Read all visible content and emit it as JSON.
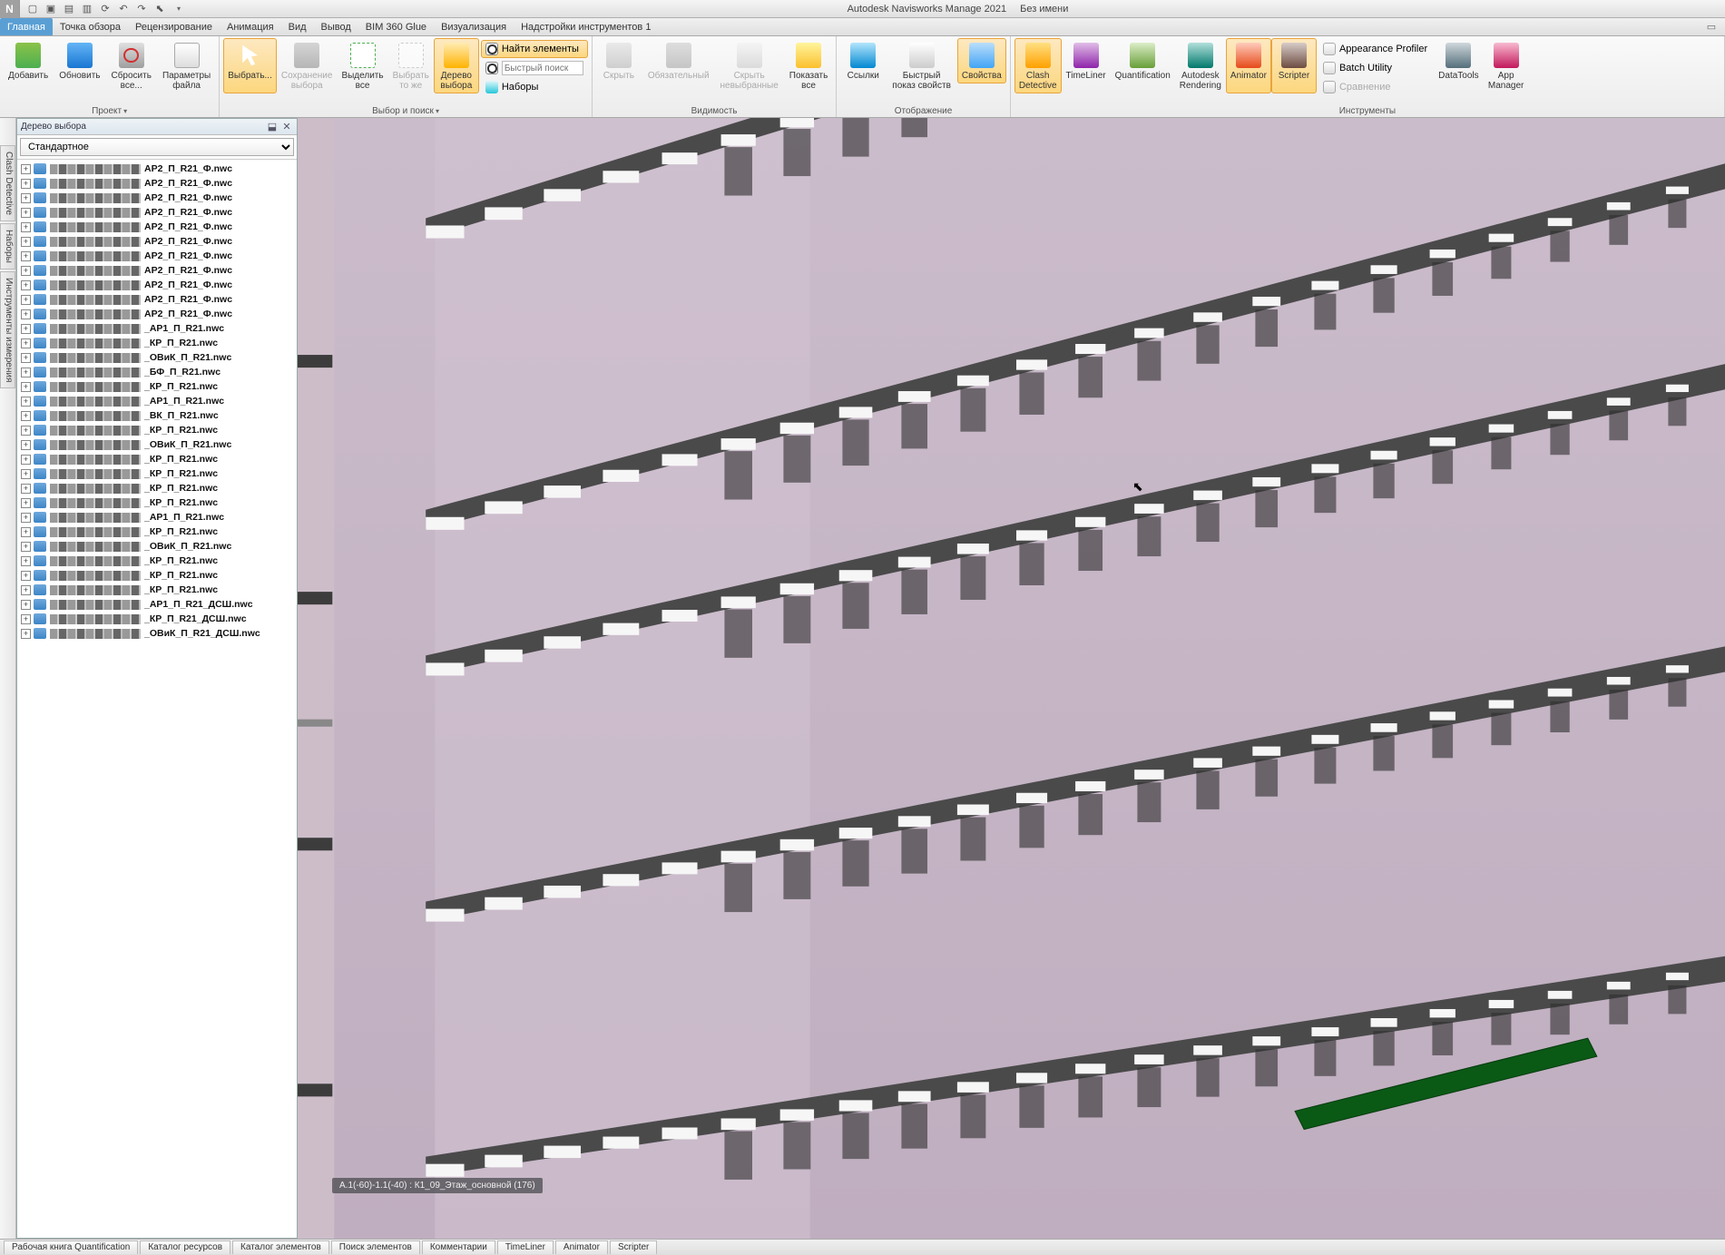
{
  "title": {
    "app": "Autodesk Navisworks Manage 2021",
    "doc": "Без имени"
  },
  "menus": [
    {
      "label": "Главная",
      "active": true
    },
    {
      "label": "Точка обзора"
    },
    {
      "label": "Рецензирование"
    },
    {
      "label": "Анимация"
    },
    {
      "label": "Вид"
    },
    {
      "label": "Вывод"
    },
    {
      "label": "BIM 360 Glue"
    },
    {
      "label": "Визуализация"
    },
    {
      "label": "Надстройки инструментов 1"
    }
  ],
  "ribbon": {
    "project": {
      "label": "Проект",
      "buttons": [
        {
          "label": "Добавить",
          "icon": "ic-add"
        },
        {
          "label": "Обновить",
          "icon": "ic-refresh"
        },
        {
          "label": "Сбросить все...",
          "icon": "ic-reset"
        },
        {
          "label": "Параметры файла",
          "icon": "ic-file"
        }
      ]
    },
    "select": {
      "label": "Выбор и поиск",
      "buttons": [
        {
          "label": "Выбрать...",
          "icon": "ic-cursor",
          "active": true
        },
        {
          "label": "Сохранение выбора",
          "icon": "ic-save",
          "disabled": true
        },
        {
          "label": "Выделить все",
          "icon": "ic-select-all"
        },
        {
          "label": "Выбрать то же",
          "icon": "ic-select-same",
          "disabled": true
        },
        {
          "label": "Дерево выбора",
          "icon": "ic-tree",
          "active": true
        }
      ],
      "side": [
        {
          "label": "Найти элементы",
          "icon": "ic-find",
          "active": true
        },
        {
          "label": "Быстрый поиск",
          "placeholder": "Быстрый поиск",
          "icon": "ic-find"
        },
        {
          "label": "Наборы",
          "icon": "ic-sets"
        }
      ]
    },
    "vis": {
      "label": "Видимость",
      "buttons": [
        {
          "label": "Скрыть",
          "icon": "ic-hide1",
          "disabled": true
        },
        {
          "label": "Обязательный",
          "icon": "ic-hide2",
          "disabled": true
        },
        {
          "label": "Скрыть невыбранные",
          "icon": "ic-hide3",
          "disabled": true
        },
        {
          "label": "Показать все",
          "icon": "ic-showall"
        }
      ]
    },
    "disp": {
      "label": "Отображение",
      "buttons": [
        {
          "label": "Ссылки",
          "icon": "ic-links"
        },
        {
          "label": "Быстрый показ свойств",
          "icon": "ic-props-quick"
        },
        {
          "label": "Свойства",
          "icon": "ic-props",
          "active": true
        }
      ]
    },
    "tools": {
      "label": "Инструменты",
      "buttons": [
        {
          "label": "Clash Detective",
          "icon": "ic-clash",
          "active": true
        },
        {
          "label": "TimeLiner",
          "icon": "ic-timeliner"
        },
        {
          "label": "Quantification",
          "icon": "ic-quant"
        },
        {
          "label": "Autodesk Rendering",
          "icon": "ic-render"
        },
        {
          "label": "Animator",
          "icon": "ic-anim",
          "active": true
        },
        {
          "label": "Scripter",
          "icon": "ic-script",
          "active": true
        }
      ],
      "side": [
        {
          "label": "Appearance Profiler",
          "icon": "ic-file"
        },
        {
          "label": "Batch Utility",
          "icon": "ic-file"
        },
        {
          "label": "Сравнение",
          "icon": "ic-file",
          "disabled": true
        }
      ],
      "after": [
        {
          "label": "DataTools",
          "icon": "ic-data"
        },
        {
          "label": "App Manager",
          "icon": "ic-appmgr"
        }
      ]
    }
  },
  "side_tabs": [
    "Clash Detective",
    "Наборы",
    "Инструменты измерения"
  ],
  "panel": {
    "title": "Дерево выбора",
    "combo": "Стандартное",
    "items": [
      "АР2_П_R21_Ф.nwc",
      "АР2_П_R21_Ф.nwc",
      "АР2_П_R21_Ф.nwc",
      "АР2_П_R21_Ф.nwc",
      "АР2_П_R21_Ф.nwc",
      "АР2_П_R21_Ф.nwc",
      "АР2_П_R21_Ф.nwc",
      "АР2_П_R21_Ф.nwc",
      "АР2_П_R21_Ф.nwc",
      "АР2_П_R21_Ф.nwc",
      "АР2_П_R21_Ф.nwc",
      "_АР1_П_R21.nwc",
      "_КР_П_R21.nwc",
      "_ОВиК_П_R21.nwc",
      "_БФ_П_R21.nwc",
      "_КР_П_R21.nwc",
      "_АР1_П_R21.nwc",
      "_ВК_П_R21.nwc",
      "_КР_П_R21.nwc",
      "_ОВиК_П_R21.nwc",
      "_КР_П_R21.nwc",
      "_КР_П_R21.nwc",
      "_КР_П_R21.nwc",
      "_КР_П_R21.nwc",
      "_АР1_П_R21.nwc",
      "_КР_П_R21.nwc",
      "_ОВиК_П_R21.nwc",
      "_КР_П_R21.nwc",
      "_КР_П_R21.nwc",
      "_КР_П_R21.nwc",
      "_АР1_П_R21_ДСШ.nwc",
      "_КР_П_R21_ДСШ.nwc",
      "_ОВиК_П_R21_ДСШ.nwc"
    ]
  },
  "hint": "А.1(-60)-1.1(-40) : К1_09_Этаж_основной (176)",
  "bottom_tabs": [
    "Рабочая книга Quantification",
    "Каталог ресурсов",
    "Каталог элементов",
    "Поиск элементов",
    "Комментарии",
    "TimeLiner",
    "Animator",
    "Scripter"
  ]
}
